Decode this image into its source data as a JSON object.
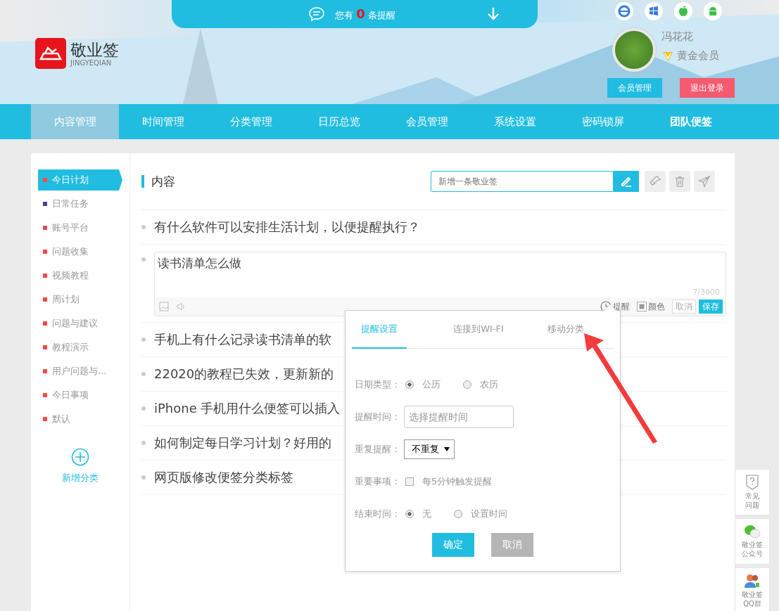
{
  "reminder_bar": {
    "prefix": "您有",
    "count": "0",
    "suffix": "条提醒"
  },
  "logo": {
    "name": "敬业签",
    "subtitle": "JINGYEQIAN"
  },
  "user": {
    "name": "冯花花",
    "level": "黄金会员",
    "buttons": [
      {
        "label": "会员管理",
        "kind": "primary"
      },
      {
        "label": "退出登录",
        "kind": "danger"
      }
    ]
  },
  "nav": [
    {
      "label": "内容管理",
      "selected": true,
      "bold": false
    },
    {
      "label": "时间管理",
      "selected": false,
      "bold": false
    },
    {
      "label": "分类管理",
      "selected": false,
      "bold": false
    },
    {
      "label": "日历总览",
      "selected": false,
      "bold": false
    },
    {
      "label": "会员管理",
      "selected": false,
      "bold": false
    },
    {
      "label": "系统设置",
      "selected": false,
      "bold": false
    },
    {
      "label": "密码锁屏",
      "selected": false,
      "bold": false
    },
    {
      "label": "团队便签",
      "selected": false,
      "bold": true
    }
  ],
  "sidebar": {
    "items": [
      {
        "label": "今日计划",
        "selected": true,
        "color": "#ff4444"
      },
      {
        "label": "日常任务",
        "selected": false,
        "color": "#4a3d8f"
      },
      {
        "label": "账号平台",
        "selected": false,
        "color": "#e0485a"
      },
      {
        "label": "问题收集",
        "selected": false,
        "color": "#ff4444"
      },
      {
        "label": "视频教程",
        "selected": false,
        "color": "#ff4444"
      },
      {
        "label": "周计划",
        "selected": false,
        "color": "#ff4444"
      },
      {
        "label": "问题与建议",
        "selected": false,
        "color": "#ff4444"
      },
      {
        "label": "教程演示",
        "selected": false,
        "color": "#ff4444"
      },
      {
        "label": "用户问题与...",
        "selected": false,
        "color": "#ff4444"
      },
      {
        "label": "今日事项",
        "selected": false,
        "color": "#ff4444"
      },
      {
        "label": "默认",
        "selected": false,
        "color": "#ff4444"
      }
    ],
    "add_label": "新增分类"
  },
  "content": {
    "title": "内容",
    "new_note": {
      "placeholder": "新增一条敬业签"
    },
    "notes": [
      {
        "kind": "text",
        "text": "有什么软件可以安排生活计划，以便提醒执行？"
      },
      {
        "kind": "editor",
        "text": "读书清单怎么做",
        "counter": "7/3000",
        "tools": [
          "提醒",
          "颜色"
        ],
        "buttons": [
          "取消",
          "保存"
        ]
      },
      {
        "kind": "text",
        "text": "手机上有什么记录读书清单的软"
      },
      {
        "kind": "text",
        "text": "22020的教程已失效，更新新的"
      },
      {
        "kind": "text",
        "text": "iPhone 手机用什么便签可以插入"
      },
      {
        "kind": "text",
        "text": "如何制定每日学习计划？好用的"
      },
      {
        "kind": "text",
        "text": "网页版修改便签分类标签"
      }
    ]
  },
  "popup": {
    "tabs": [
      {
        "label": "提醒设置",
        "selected": true
      },
      {
        "label": "连接到WI-FI",
        "selected": false
      },
      {
        "label": "移动分类",
        "selected": false
      }
    ],
    "date_type": {
      "label": "日期类型：",
      "options": [
        {
          "label": "公历",
          "selected": true
        },
        {
          "label": "农历",
          "selected": false
        }
      ]
    },
    "remind_time": {
      "label": "提醒时间：",
      "placeholder": "选择提醒时间"
    },
    "repeat": {
      "label": "重复提醒：",
      "value": "不重复"
    },
    "important": {
      "label": "重要事项：",
      "option": "每5分钟触发提醒",
      "checked": false
    },
    "end_time": {
      "label": "结束时间：",
      "options": [
        {
          "label": "无",
          "selected": true
        },
        {
          "label": "设置时间",
          "selected": false
        }
      ]
    },
    "buttons": [
      {
        "label": "确定",
        "kind": "primary"
      },
      {
        "label": "取消",
        "kind": "secondary"
      }
    ]
  },
  "side_tools": [
    {
      "kind": "faq",
      "lines": [
        "常见",
        "问题"
      ]
    },
    {
      "kind": "wechat",
      "lines": [
        "敬业签",
        "公众号"
      ]
    },
    {
      "kind": "qq",
      "lines": [
        "敬业签",
        "QQ群"
      ]
    }
  ]
}
